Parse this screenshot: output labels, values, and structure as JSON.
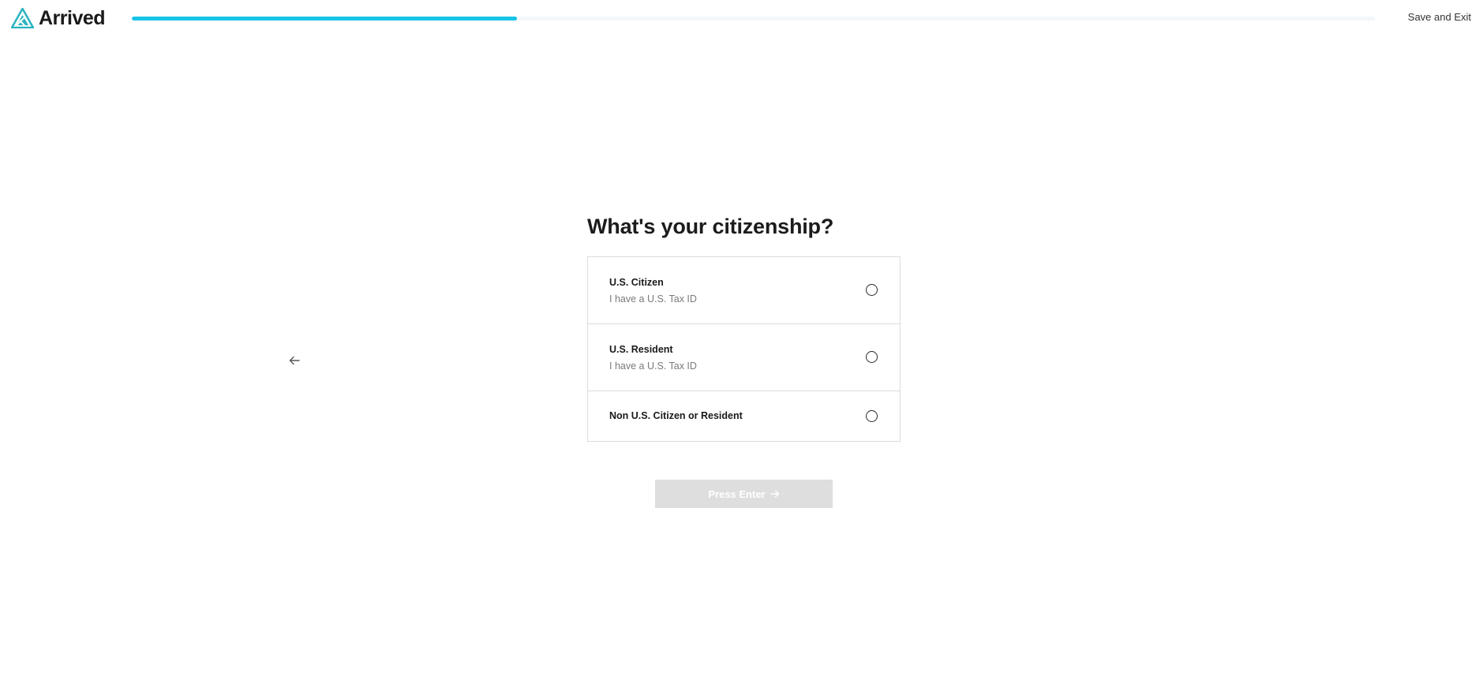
{
  "header": {
    "logo_text": "Arrived",
    "progress_percent": 31,
    "save_exit_label": "Save and Exit"
  },
  "colors": {
    "accent": "#17c3e6",
    "logo_teal": "#2bb3c0",
    "button_disabled": "#dedede"
  },
  "navigation": {
    "back_icon": "arrow-left-icon"
  },
  "question": {
    "title": "What's your citizenship?",
    "options": [
      {
        "title": "U.S. Citizen",
        "subtitle": "I have a U.S. Tax ID",
        "selected": false
      },
      {
        "title": "U.S. Resident",
        "subtitle": "I have a U.S. Tax ID",
        "selected": false
      },
      {
        "title": "Non U.S. Citizen or Resident",
        "selected": false
      }
    ]
  },
  "submit": {
    "label": "Press Enter",
    "icon": "arrow-right-icon",
    "disabled": true
  }
}
